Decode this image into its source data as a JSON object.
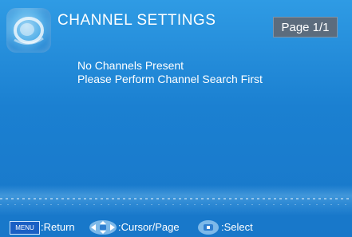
{
  "header": {
    "title": "CHANNEL SETTINGS",
    "page_indicator": "Page 1/1"
  },
  "message": {
    "line1": "No Channels Present",
    "line2": "Please Perform Channel Search First"
  },
  "footer": {
    "menu_key_label": "MENU",
    "return_label": ":Return",
    "cursor_label": ":Cursor/Page",
    "select_label": ":Select"
  },
  "colors": {
    "background": "#1b80d1",
    "page_badge": "#5c6c7d"
  },
  "icons": {
    "logo": "satellite-logo-icon",
    "cursor_page": "dpad-cursor-icon",
    "select": "ok-select-icon"
  }
}
